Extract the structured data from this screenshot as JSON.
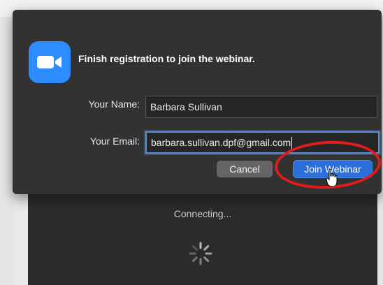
{
  "dialog": {
    "title": "Finish registration to join the webinar.",
    "name_label": "Your Name:",
    "name_value": "Barbara Sullivan",
    "email_label": "Your Email:",
    "email_value": "barbara.sullivan.dpf@gmail.com",
    "cancel_label": "Cancel",
    "join_label": "Join Webinar",
    "logo_icon": "zoom-camera-icon",
    "accent_color": "#2d8cff"
  },
  "background": {
    "status_text": "Connecting..."
  },
  "annotation": {
    "highlight_color": "#e01c1c"
  }
}
